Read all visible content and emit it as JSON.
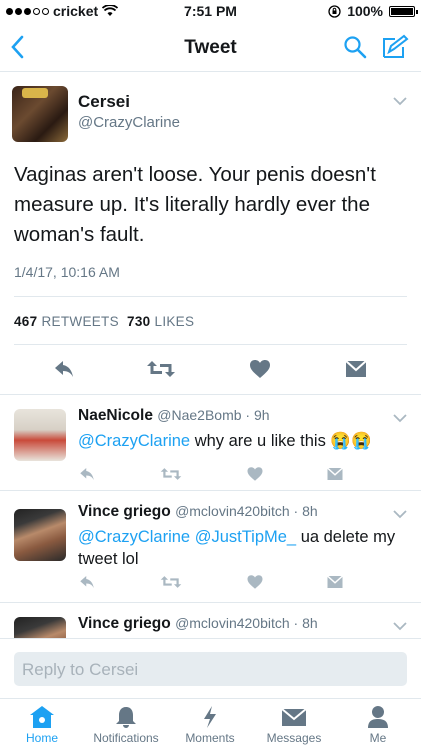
{
  "status": {
    "carrier": "cricket",
    "time": "7:51 PM",
    "battery": "100%"
  },
  "nav": {
    "title": "Tweet",
    "back_icon": "chevron-left-icon",
    "search_icon": "search-icon",
    "compose_icon": "compose-icon"
  },
  "tweet": {
    "name": "Cersei",
    "handle": "@CrazyClarine",
    "text": "Vaginas aren't loose. Your penis doesn't measure up. It's literally hardly ever the woman's fault.",
    "timestamp": "1/4/17, 10:16 AM",
    "retweets": "467",
    "retweets_label": "RETWEETS",
    "likes": "730",
    "likes_label": "LIKES"
  },
  "replies": [
    {
      "name": "NaeNicole",
      "meta": "@Nae2Bomb · 9h",
      "mention": "@CrazyClarine",
      "text": " why are u like this 😭😭"
    },
    {
      "name": "Vince griego",
      "meta": "@mclovin420bitch · 8h",
      "mention": "@CrazyClarine @JustTipMe_",
      "text": " ua delete my tweet lol"
    },
    {
      "name": "Vince griego",
      "meta": "@mclovin420bitch · 8h"
    }
  ],
  "reply_bar": {
    "placeholder": "Reply to Cersei"
  },
  "tabs": [
    {
      "label": "Home"
    },
    {
      "label": "Notifications"
    },
    {
      "label": "Moments"
    },
    {
      "label": "Messages"
    },
    {
      "label": "Me"
    }
  ],
  "colors": {
    "accent": "#1da1f2",
    "muted": "#657786",
    "icon_gray": "#aab8c2"
  }
}
